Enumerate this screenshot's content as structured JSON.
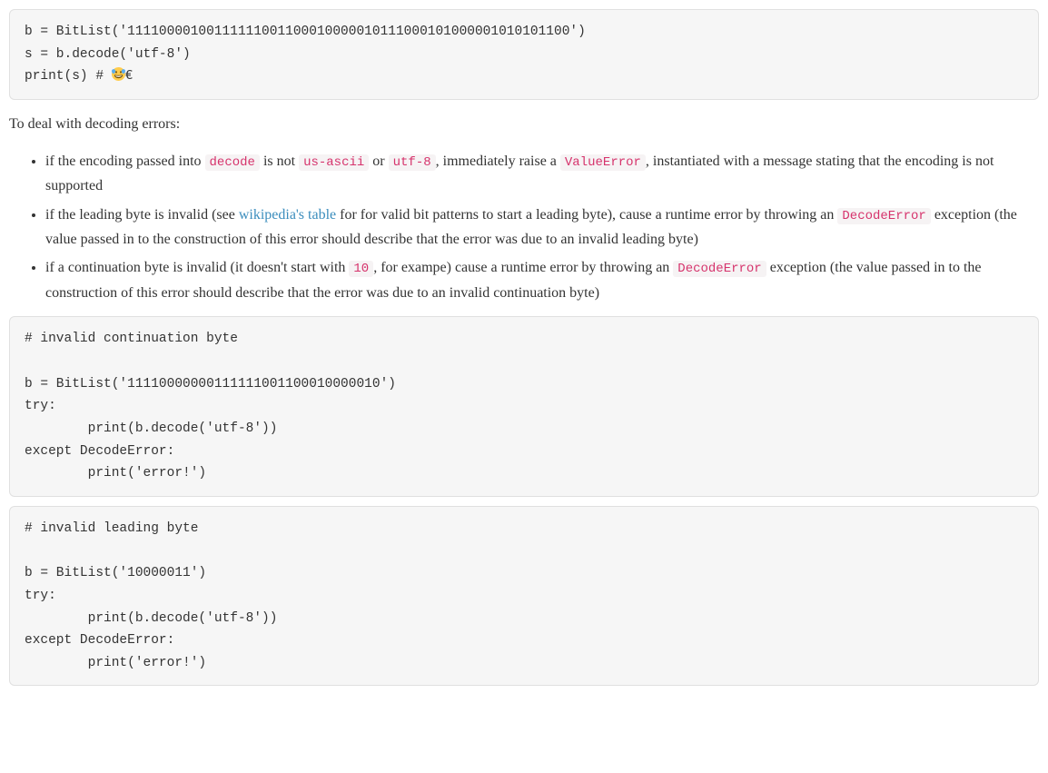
{
  "code_block_1": "b = BitList('11110000100111111001100010000010111000101000001010101100')\ns = b.decode('utf-8')\nprint(s) # ",
  "code_block_1_tail": "€",
  "para_intro": "To deal with decoding errors:",
  "bullets": {
    "b1": {
      "t1": "if the encoding passed into ",
      "c1": "decode",
      "t2": " is not ",
      "c2": "us-ascii",
      "t3": " or ",
      "c3": "utf-8",
      "t4": ", immediately raise a ",
      "c4": "ValueError",
      "t5": ", instantiated with a message stating that the encoding is not supported"
    },
    "b2": {
      "t1": "if the leading byte is invalid (see ",
      "link": "wikipedia's table",
      "t2": " for for valid bit patterns to start a leading byte), cause a runtime error by throwing an ",
      "c1": "DecodeError",
      "t3": " exception (the value passed in to the construction of this error should describe that the error was due to an invalid leading byte)"
    },
    "b3": {
      "t1": "if a continuation byte is invalid (it doesn't start with ",
      "c1": "10",
      "t2": ", for exampe) cause a runtime error by throwing an ",
      "c2": "DecodeError",
      "t3": " exception (the value passed in to the construction of this error should describe that the error was due to an invalid continuation byte)"
    }
  },
  "code_block_2": "# invalid continuation byte\n\nb = BitList('11110000000111111001100010000010')\ntry:\n        print(b.decode('utf-8'))\nexcept DecodeError:\n        print('error!')",
  "code_block_3": "# invalid leading byte\n\nb = BitList('10000011')\ntry:\n        print(b.decode('utf-8'))\nexcept DecodeError:\n        print('error!')"
}
